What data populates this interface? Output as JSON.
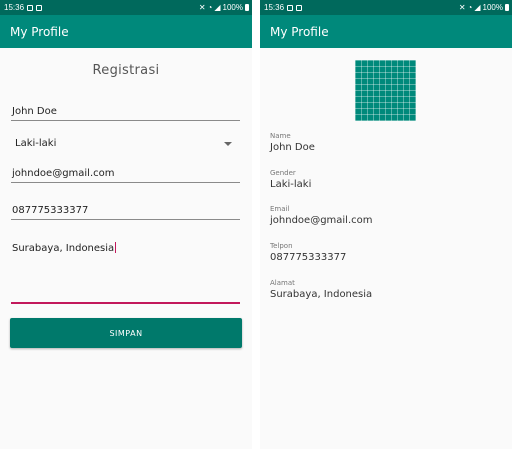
{
  "colors": {
    "status_bar": "#00695c",
    "app_bar": "#00897b",
    "button": "#00796b",
    "accent": "#c2185b"
  },
  "status_bar": {
    "time": "15:36",
    "battery": "100%",
    "icons": [
      "image-notification-icon",
      "sd-card-icon",
      "mute-icon",
      "wifi-icon",
      "signal-icon",
      "battery-icon"
    ]
  },
  "left": {
    "app_title": "My Profile",
    "form_title": "Registrasi",
    "name_value": "John Doe",
    "gender_value": "Laki-laki",
    "email_value": "johndoe@gmail.com",
    "phone_value": "087775333377",
    "address_value": "Surabaya, Indonesia",
    "save_label": "SIMPAN"
  },
  "right": {
    "app_title": "My Profile",
    "fields": [
      {
        "label": "Name",
        "value": "John Doe"
      },
      {
        "label": "Gender",
        "value": "Laki-laki"
      },
      {
        "label": "Email",
        "value": "johndoe@gmail.com"
      },
      {
        "label": "Telpon",
        "value": "087775333377"
      },
      {
        "label": "Alamat",
        "value": "Surabaya, Indonesia"
      }
    ]
  }
}
